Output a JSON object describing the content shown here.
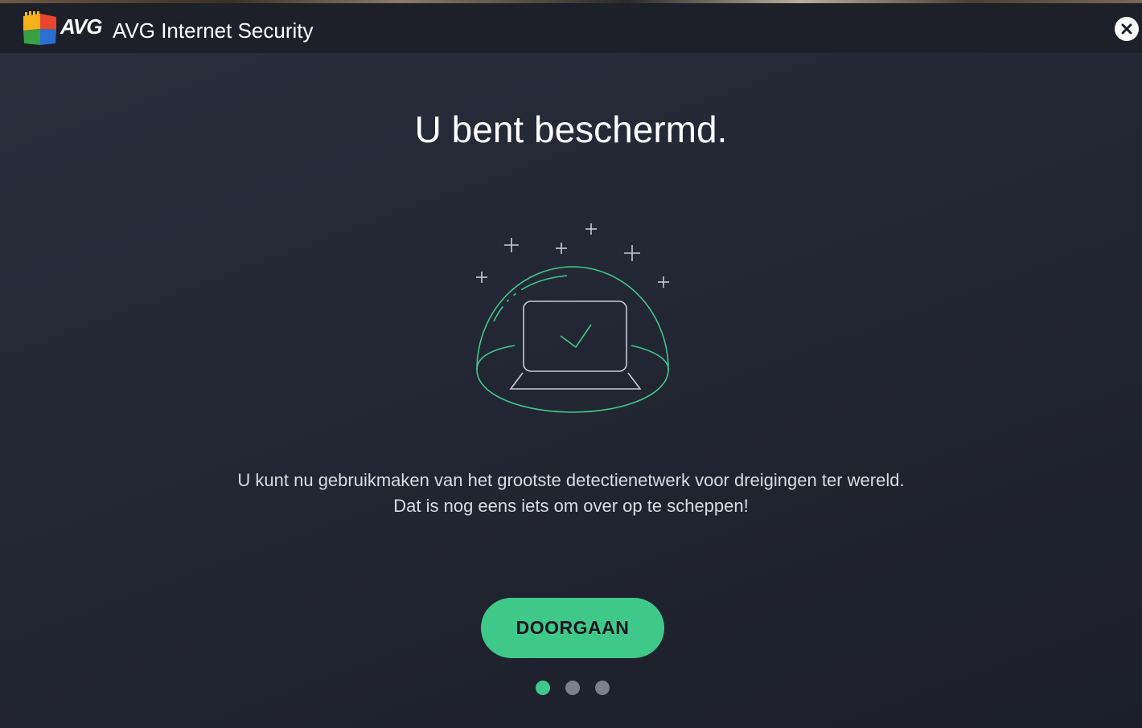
{
  "app": {
    "brand": "AVG",
    "title": "AVG Internet Security",
    "close_label": "×"
  },
  "main": {
    "heading": "U bent beschermd.",
    "description_line1": "U kunt nu gebruikmaken van het grootste detectienetwerk voor dreigingen ter wereld.",
    "description_line2": "Dat is nog eens iets om over op te scheppen!",
    "continue_label": "DOORGAAN",
    "illustration_icon": "protected-laptop-dome-icon"
  },
  "pagination": {
    "total": 3,
    "active_index": 0
  },
  "colors": {
    "accent": "#3ec98a",
    "background": "#232733",
    "titlebar": "#1d2029",
    "text": "#ffffff",
    "dot_inactive": "#7c808a"
  }
}
